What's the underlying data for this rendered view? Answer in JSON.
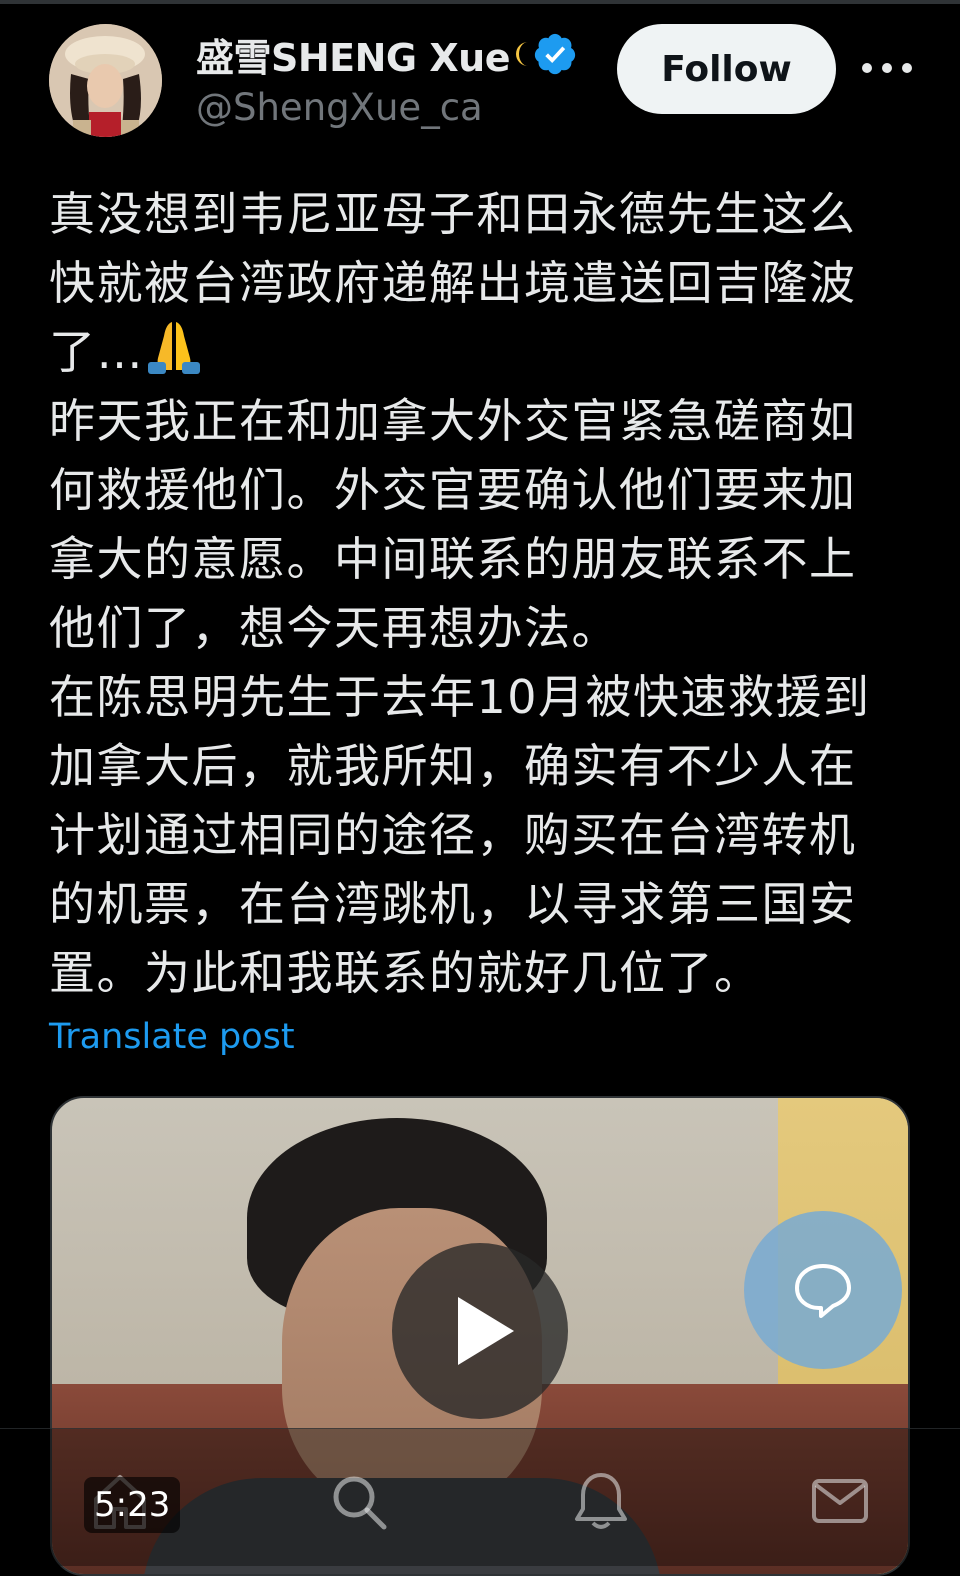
{
  "author": {
    "display_name": "盛雪SHENG Xue",
    "handle": "@ShengXue_ca",
    "avatar_icon": "avatar-photo",
    "verified_icon": "verified-badge-icon",
    "verified_color": "#1d9bf0"
  },
  "follow_label": "Follow",
  "more_icon": "more-options-icon",
  "post": {
    "lines": [
      "真没想到韦尼亚母子和田永德先生这么",
      "快就被台湾政府递解出境遣送回吉隆波",
      "了…",
      "昨天我正在和加拿大外交官紧急磋商如",
      "何救援他们。外交官要确认他们要来加",
      "拿大的意愿。中间联系的朋友联系不上",
      "他们了，想今天再想办法。",
      "在陈思明先生于去年10月被快速救援到",
      "加拿大后，就我所知，确实有不少人在",
      "计划通过相同的途径，购买在台湾转机",
      "的机票，在台湾跳机，以寻求第三国安",
      "置。为此和我联系的就好几位了。"
    ],
    "emoji": "🙏",
    "translate_label": "Translate post"
  },
  "media": {
    "duration": "5:23",
    "play_icon": "play-icon",
    "chat_icon": "chat-bubble-icon"
  },
  "nav": {
    "items": [
      "home-icon",
      "search-icon",
      "notifications-icon",
      "messages-icon"
    ]
  },
  "colors": {
    "background": "#000000",
    "text": "#e7e9ea",
    "secondary_text": "#71767b",
    "link": "#1d9bf0",
    "follow_bg": "#eff3f4"
  }
}
